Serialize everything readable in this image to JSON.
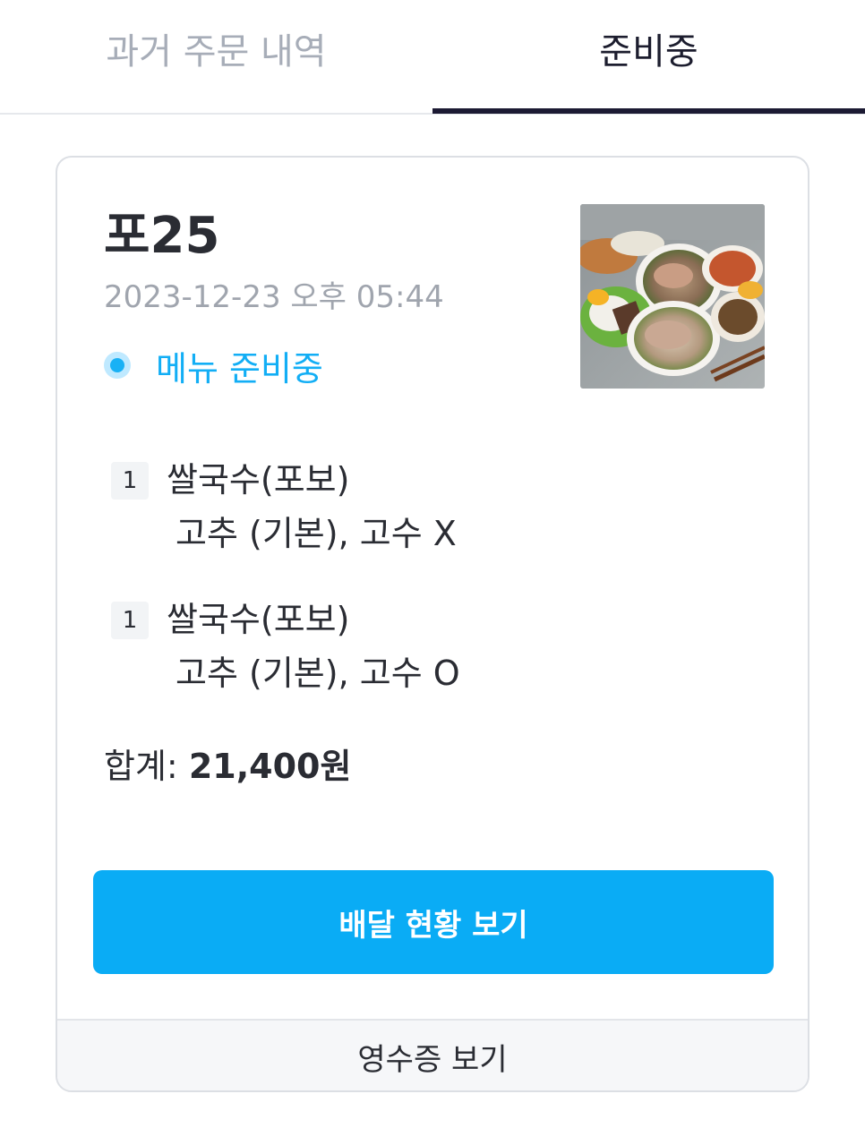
{
  "tabs": [
    {
      "label": "과거 주문 내역",
      "active": false
    },
    {
      "label": "준비중",
      "active": true
    }
  ],
  "order": {
    "store_name": "포25",
    "date": "2023-12-23 오후 05:44",
    "status": "메뉴 준비중",
    "items": [
      {
        "qty": "1",
        "name": "쌀국수(포보)",
        "options": "고추 (기본), 고수 X"
      },
      {
        "qty": "1",
        "name": "쌀국수(포보)",
        "options": "고추 (기본), 고수 O"
      }
    ],
    "total_label": "합계: ",
    "total_value": "21,400원",
    "delivery_button": "배달 현황 보기",
    "receipt_link": "영수증 보기"
  },
  "colors": {
    "accent": "#0aacf5",
    "status": "#12aef5",
    "tab_indicator": "#1c1a33"
  }
}
